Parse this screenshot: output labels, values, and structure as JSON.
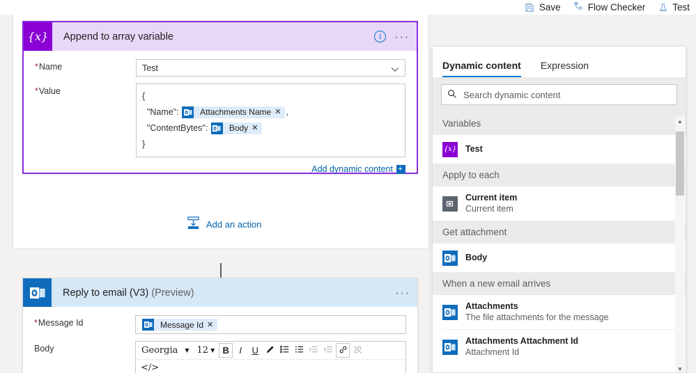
{
  "topbar": {
    "items": [
      {
        "label": "Save",
        "icon": "save-icon"
      },
      {
        "label": "Flow Checker",
        "icon": "flow-checker-icon"
      },
      {
        "label": "Test",
        "icon": "test-flask-icon"
      }
    ]
  },
  "canvas": {
    "append_card": {
      "title": "Append to array variable",
      "icon": "variable-icon",
      "icon_glyph": "{x}",
      "info_glyph": "i",
      "menu_glyph": "···",
      "fields": {
        "name_label": "Name",
        "name_value": "Test",
        "value_label": "Value",
        "value_lines": {
          "open_brace": "{",
          "name_key": "\"Name\":",
          "name_chip": "Attachments Name",
          "name_comma": ",",
          "content_key": "\"ContentBytes\":",
          "content_chip": "Body",
          "close_brace": "}"
        }
      },
      "add_dynamic_content": "Add dynamic content",
      "add_dynamic_plus": "+"
    },
    "add_action": "Add an action",
    "reply_card": {
      "title": "Reply to email (V3)",
      "preview": "(Preview)",
      "menu_glyph": "···",
      "message_id_label": "Message Id",
      "message_id_chip": "Message Id",
      "body_label": "Body",
      "editor": {
        "font_family": "Georgia",
        "font_size": "12",
        "code_view": "</>",
        "buttons": [
          {
            "name": "bold-button",
            "glyph": "B"
          },
          {
            "name": "italic-button",
            "glyph": "I"
          },
          {
            "name": "underline-button",
            "glyph": "U"
          },
          {
            "name": "text-color-button",
            "glyph": "✎"
          },
          {
            "name": "bulleted-list-button",
            "glyph": "☰"
          },
          {
            "name": "numbered-list-button",
            "glyph": "≡"
          },
          {
            "name": "indent-button",
            "glyph": "⇥"
          },
          {
            "name": "outdent-button",
            "glyph": "⇤"
          },
          {
            "name": "link-button",
            "glyph": "🔗"
          },
          {
            "name": "unlink-button",
            "glyph": "🔗"
          }
        ]
      }
    }
  },
  "panel": {
    "tabs": [
      {
        "label": "Dynamic content",
        "active": true
      },
      {
        "label": "Expression",
        "active": false
      }
    ],
    "search_placeholder": "Search dynamic content",
    "groups": [
      {
        "title": "Variables",
        "items": [
          {
            "title": "Test",
            "subtitle": "",
            "icon": "variable-icon",
            "icon_kind": "var",
            "glyph": "{x}"
          }
        ]
      },
      {
        "title": "Apply to each",
        "items": [
          {
            "title": "Current item",
            "subtitle": "Current item",
            "icon": "current-item-icon",
            "icon_kind": "cur",
            "glyph": "❐"
          }
        ]
      },
      {
        "title": "Get attachment",
        "items": [
          {
            "title": "Body",
            "subtitle": "",
            "icon": "outlook-icon",
            "icon_kind": "otl",
            "glyph": ""
          }
        ]
      },
      {
        "title": "When a new email arrives",
        "items": [
          {
            "title": "Attachments",
            "subtitle": "The file attachments for the message",
            "icon": "outlook-icon",
            "icon_kind": "otl",
            "glyph": ""
          },
          {
            "title": "Attachments Attachment Id",
            "subtitle": "Attachment Id",
            "icon": "outlook-icon",
            "icon_kind": "otl",
            "glyph": ""
          }
        ]
      }
    ],
    "scrollbar": {
      "up_glyph": "▲",
      "down_glyph": "▼"
    }
  },
  "colors": {
    "accent": "#0078d4",
    "variable_purple": "#8a00d4",
    "outlook_blue": "#0f6cbd",
    "chip_bg": "#deecf9",
    "required_red": "#a4262c"
  }
}
